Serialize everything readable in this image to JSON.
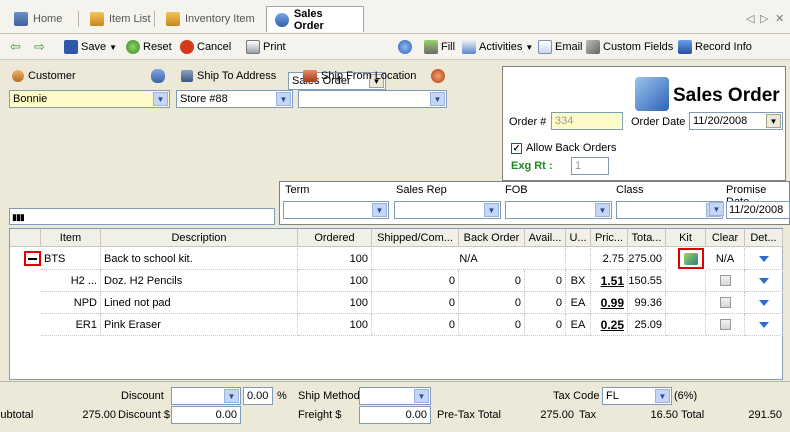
{
  "tabs": [
    {
      "label": "Home",
      "icon": "home-icon"
    },
    {
      "label": "Item List",
      "icon": "item-list-icon"
    },
    {
      "label": "Inventory Item",
      "icon": "inventory-item-icon"
    },
    {
      "label": "Sales Order",
      "icon": "sales-order-icon",
      "active": true
    }
  ],
  "tab_controls": {
    "prev": "◁",
    "next": "▷",
    "close": "✕"
  },
  "toolbar": {
    "save": "Save",
    "reset": "Reset",
    "cancel": "Cancel",
    "print": "Print",
    "print_option": "Sales Order",
    "fill": "Fill",
    "activities": "Activities",
    "email": "Email",
    "custom_fields": "Custom Fields",
    "record_info": "Record Info"
  },
  "customer": {
    "label": "Customer",
    "value": "Bonnie"
  },
  "ship_to": {
    "label": "Ship To Address",
    "value": "Store #88"
  },
  "ship_from": {
    "label": "Ship From Location",
    "value": ""
  },
  "order_box": {
    "title": "Sales Order",
    "order_no_label": "Order #",
    "order_no": "334",
    "order_date_label": "Order Date",
    "order_date": "11/20/2008",
    "allow_back_orders": "Allow Back Orders",
    "exg_rt_label": "Exg Rt :",
    "exg_rt": "1"
  },
  "terms": {
    "term": "Term",
    "sales_rep": "Sales Rep",
    "fob": "FOB",
    "class": "Class",
    "promise_date": "Promise Date",
    "promise_date_value": "11/20/2008"
  },
  "grid": {
    "columns": [
      "Item",
      "Description",
      "Ordered",
      "Shipped/Com...",
      "Back Order",
      "Avail...",
      "U...",
      "Pric...",
      "Tota...",
      "Kit",
      "Clear",
      "Det..."
    ],
    "kit_row": {
      "item": "BTS",
      "description": "Back to school kit.",
      "ordered": "100",
      "na": "N/A",
      "price": "2.75",
      "total": "275.00",
      "clear": "N/A"
    },
    "rows": [
      {
        "item": "H2 ...",
        "description": "Doz. H2 Pencils",
        "ordered": "100",
        "shipped": "0",
        "back_order": "0",
        "avail": "0",
        "unit": "BX",
        "price": "1.51",
        "total": "150.55"
      },
      {
        "item": "NPD",
        "description": "Lined not pad",
        "ordered": "100",
        "shipped": "0",
        "back_order": "0",
        "avail": "0",
        "unit": "EA",
        "price": "0.99",
        "total": "99.36"
      },
      {
        "item": "ER1",
        "description": "Pink Eraser",
        "ordered": "100",
        "shipped": "0",
        "back_order": "0",
        "avail": "0",
        "unit": "EA",
        "price": "0.25",
        "total": "25.09"
      }
    ]
  },
  "footer": {
    "discount_label": "Discount",
    "discount_pct": "0.00",
    "pct_sign": "%",
    "ship_method_label": "Ship Method",
    "tax_code_label": "Tax Code",
    "tax_code": "FL",
    "tax_rate": "(6%)",
    "subtotal_label": "Subtotal",
    "subtotal": "275.00",
    "discount_amt_label": "Discount $",
    "discount_amt": "0.00",
    "freight_label": "Freight $",
    "freight": "0.00",
    "pretax_label": "Pre-Tax Total",
    "pretax": "275.00",
    "tax_label": "Tax",
    "tax": "16.50",
    "total_label": "Total",
    "total": "291.50"
  },
  "colors": {
    "accent_blue": "#2c6bd0",
    "highlight_red": "#e00000",
    "input_yellow": "#fffbc8",
    "exg_green": "#1f8a1f"
  }
}
